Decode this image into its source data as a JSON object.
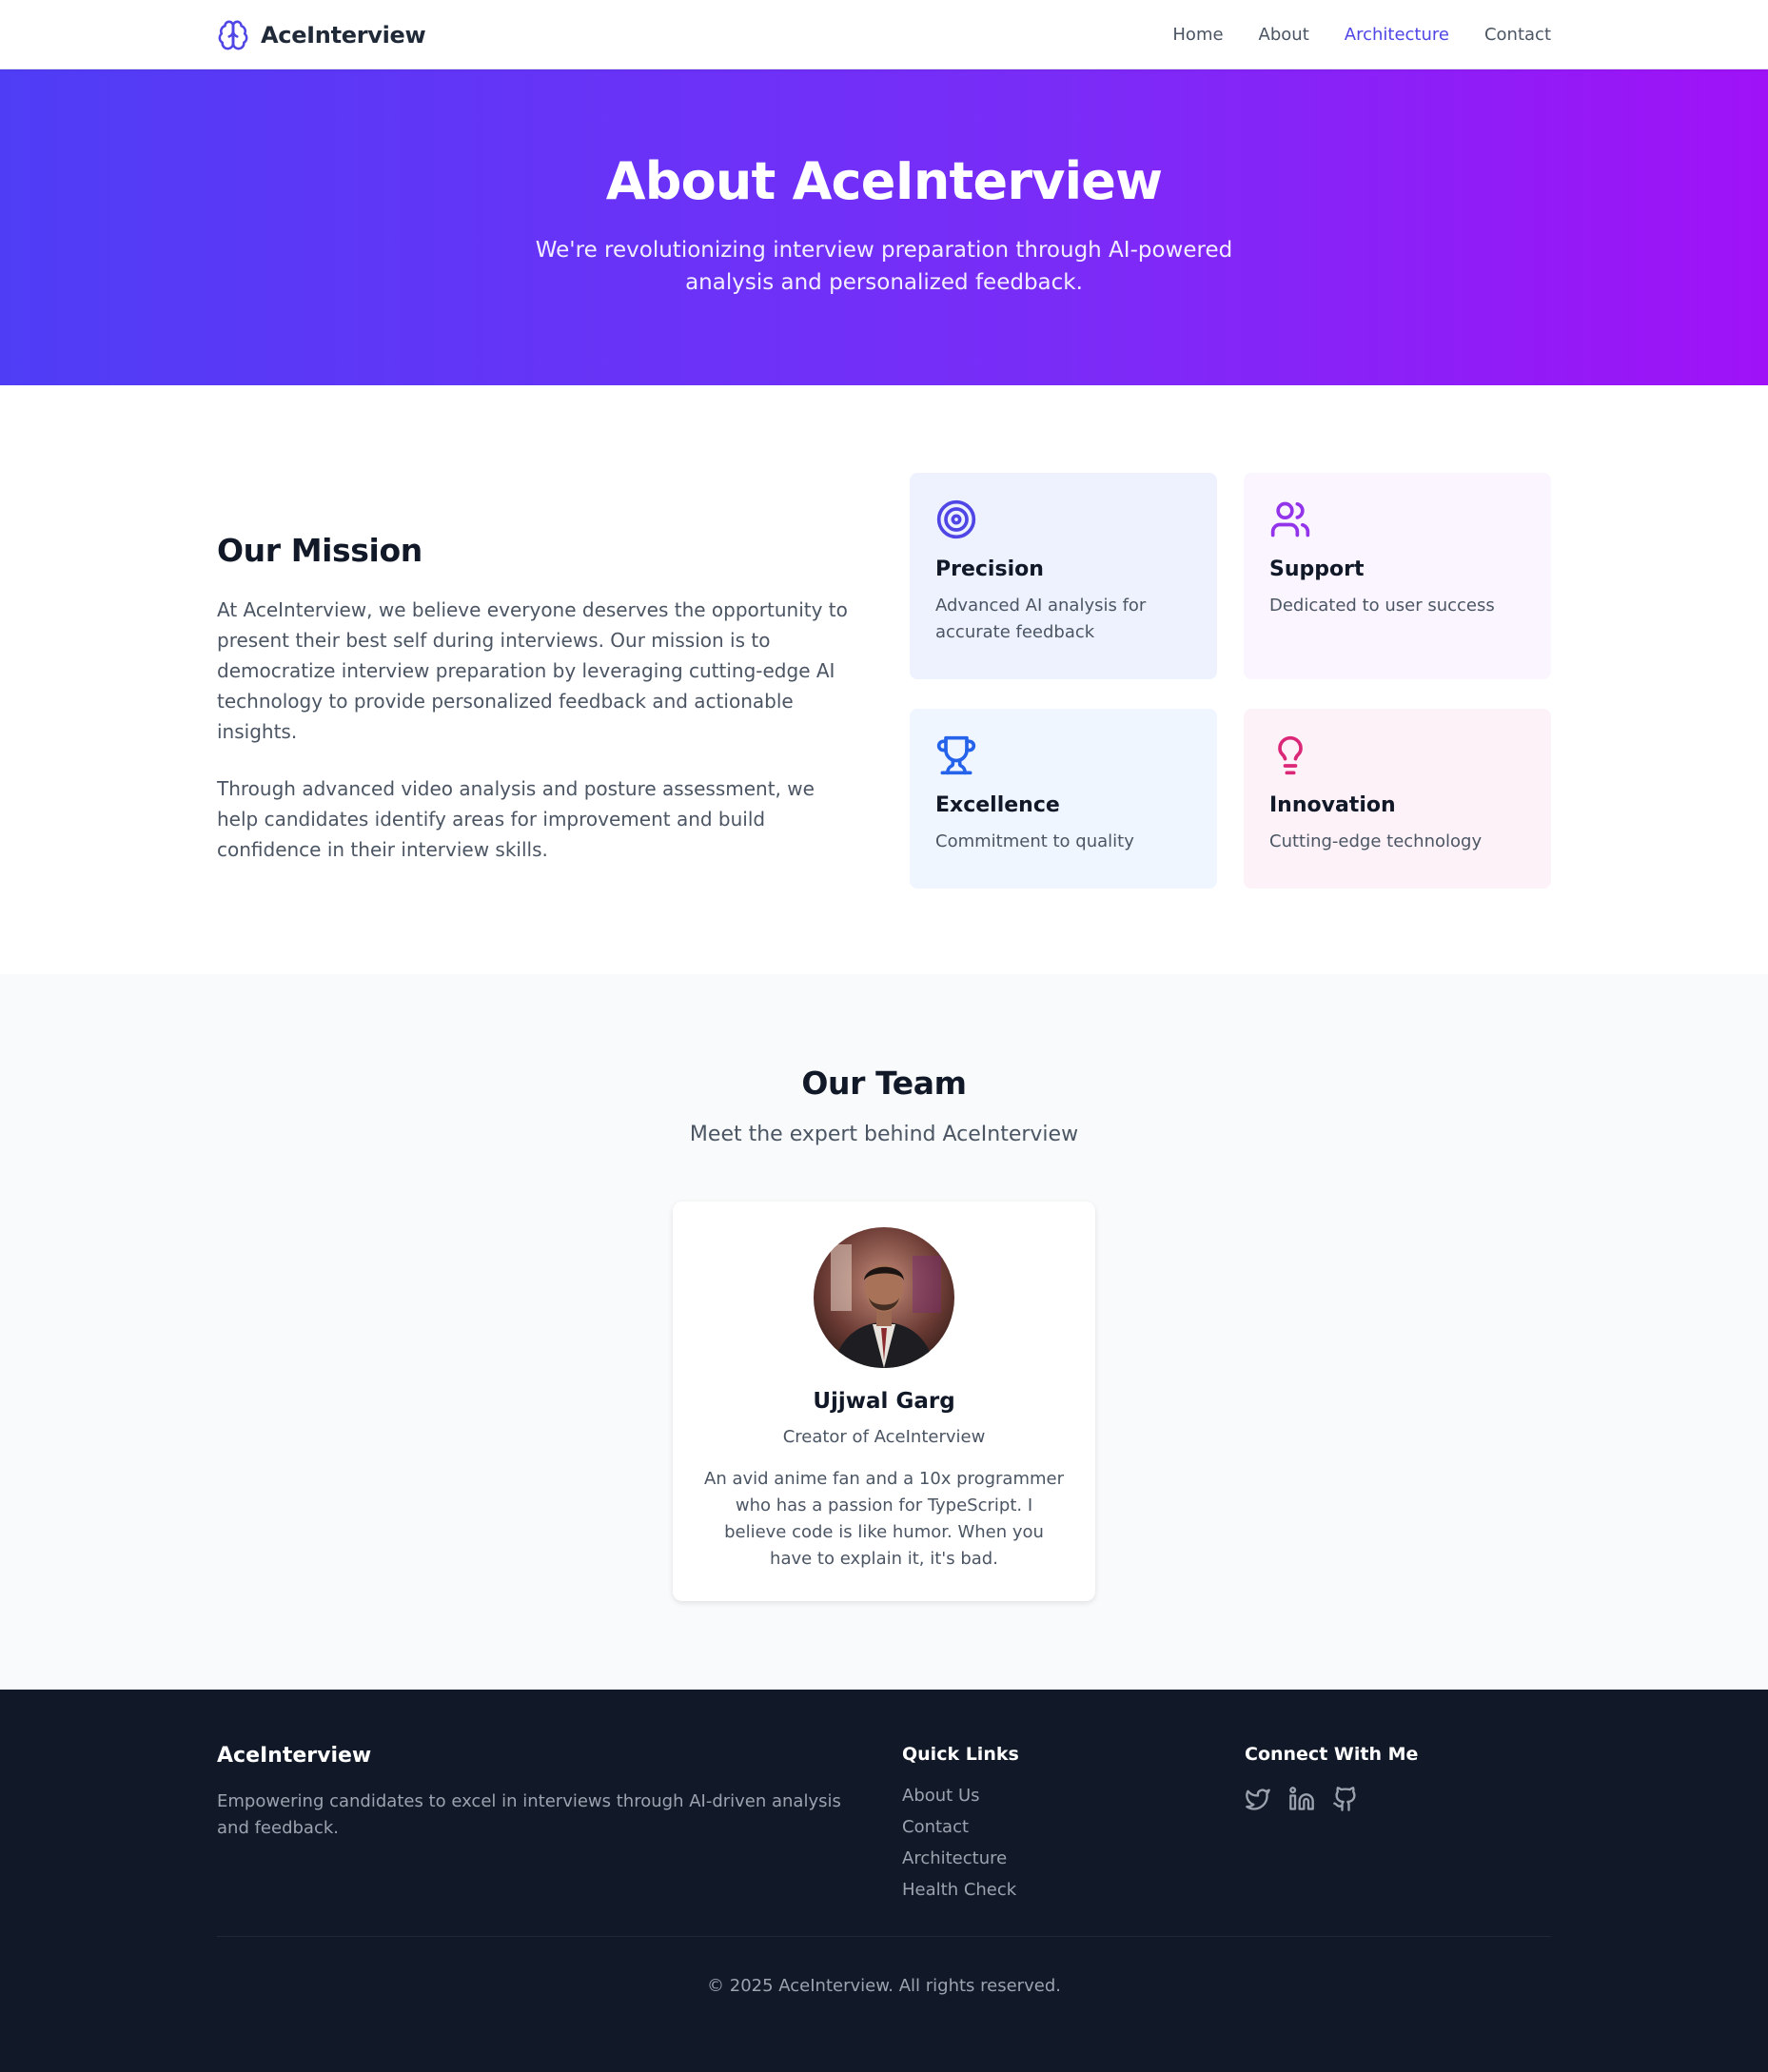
{
  "nav": {
    "brand": "AceInterview",
    "brand_icon": "brain-icon",
    "links": [
      {
        "label": "Home"
      },
      {
        "label": "About"
      },
      {
        "label": "Architecture",
        "active": true
      },
      {
        "label": "Contact"
      }
    ]
  },
  "hero": {
    "title": "About AceInterview",
    "subtitle": "We're revolutionizing interview preparation through AI-powered analysis and personalized feedback."
  },
  "mission": {
    "title": "Our Mission",
    "paragraphs": [
      "At AceInterview, we believe everyone deserves the opportunity to present their best self during interviews. Our mission is to democratize interview preparation by leveraging cutting-edge AI technology to provide personalized feedback and actionable insights.",
      "Through advanced video analysis and posture assessment, we help candidates identify areas for improvement and build confidence in their interview skills."
    ],
    "cards": [
      {
        "title": "Precision",
        "text": "Advanced AI analysis for accurate feedback",
        "icon": "target-icon",
        "color": "#4f46e5"
      },
      {
        "title": "Support",
        "text": "Dedicated to user success",
        "icon": "users-icon",
        "color": "#9333ea"
      },
      {
        "title": "Excellence",
        "text": "Commitment to quality",
        "icon": "trophy-icon",
        "color": "#2563eb"
      },
      {
        "title": "Innovation",
        "text": "Cutting-edge technology",
        "icon": "lightbulb-icon",
        "color": "#db2777"
      }
    ]
  },
  "team": {
    "title": "Our Team",
    "subtitle": "Meet the expert behind AceInterview",
    "member": {
      "name": "Ujjwal Garg",
      "role": "Creator of AceInterview",
      "bio": "An avid anime fan and a 10x programmer who has a passion for TypeScript. I believe code is like humor. When you have to explain it, it's bad."
    }
  },
  "footer": {
    "brand": "AceInterview",
    "tagline": "Empowering candidates to excel in interviews through AI-driven analysis and feedback.",
    "quick_links_title": "Quick Links",
    "quick_links": [
      "About Us",
      "Contact",
      "Architecture",
      "Health Check"
    ],
    "connect_title": "Connect With Me",
    "socials": [
      "twitter-icon",
      "linkedin-icon",
      "github-icon"
    ],
    "copyright": "© 2025 AceInterview. All rights reserved."
  },
  "colors": {
    "accent": "#4f46e5",
    "hero_start": "#4f3df6",
    "hero_end": "#9f12f7",
    "footer_bg": "#111827"
  }
}
